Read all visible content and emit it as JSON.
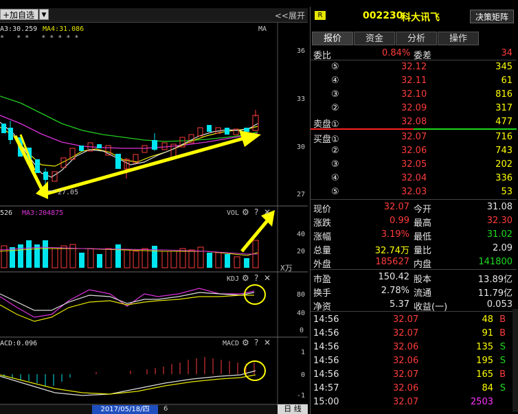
{
  "toolbar": {
    "add_label": "+加自选",
    "dropdown": "▼",
    "expand_label": "<<展开"
  },
  "ma": {
    "ma3": "A3:30.259",
    "ma4": "MA4:31.086",
    "tag": "MA",
    "stars": "*   * *   * * * * *"
  },
  "price_axis": [
    "36",
    "33",
    "30",
    "27"
  ],
  "low_label": "27.05",
  "vol": {
    "ma_prefix": "526",
    "ma3": "MA3:204875",
    "tag": "VOL",
    "axis": [
      "40",
      "20"
    ],
    "unit": "X万"
  },
  "kdj": {
    "tag": "KDJ",
    "axis": [
      "80",
      "40",
      "0"
    ]
  },
  "macd": {
    "label": "ACD:0.096",
    "tag": "MACD",
    "axis": [
      "1",
      "0",
      "-1"
    ]
  },
  "bottom": {
    "date": "2017/05/18/四",
    "count": "6",
    "period": "日  线"
  },
  "panel": {
    "badge": "R",
    "code": "002230",
    "name": "科大讯飞",
    "decision_button": "决策矩阵",
    "tabs": [
      "报价",
      "资金",
      "分析",
      "操作"
    ],
    "weibi_label": "委比",
    "weibi_value": "0.84%",
    "weicha_label": "委差",
    "weicha_value": "34",
    "sell": [
      {
        "label": "⑤",
        "price": "32.12",
        "vol": "345"
      },
      {
        "label": "④",
        "price": "32.11",
        "vol": "61"
      },
      {
        "label": "③",
        "price": "32.10",
        "vol": "816"
      },
      {
        "label": "②",
        "price": "32.09",
        "vol": "317"
      },
      {
        "label": "卖盘①",
        "price": "32.08",
        "vol": "477"
      }
    ],
    "buy": [
      {
        "label": "买盘①",
        "price": "32.07",
        "vol": "716"
      },
      {
        "label": "②",
        "price": "32.06",
        "vol": "743"
      },
      {
        "label": "③",
        "price": "32.05",
        "vol": "202"
      },
      {
        "label": "④",
        "price": "32.04",
        "vol": "336"
      },
      {
        "label": "⑤",
        "price": "32.03",
        "vol": "53"
      }
    ],
    "quote": [
      {
        "l1": "现价",
        "v1": "32.07",
        "l2": "今开",
        "v2": "31.08",
        "c1": "red",
        "c2": "wht"
      },
      {
        "l1": "涨跌",
        "v1": "0.99",
        "l2": "最高",
        "v2": "32.30",
        "c1": "red",
        "c2": "red"
      },
      {
        "l1": "涨幅",
        "v1": "3.19%",
        "l2": "最低",
        "v2": "31.02",
        "c1": "red",
        "c2": "grn"
      },
      {
        "l1": "总量",
        "v1": "32.74万",
        "l2": "量比",
        "v2": "2.09",
        "c1": "yel",
        "c2": "wht"
      },
      {
        "l1": "外盘",
        "v1": "185627",
        "l2": "内盘",
        "v2": "141800",
        "c1": "red",
        "c2": "grn"
      }
    ],
    "fund": [
      {
        "l1": "市盈",
        "v1": "150.42",
        "l2": "股本",
        "v2": "13.89亿"
      },
      {
        "l1": "换手",
        "v1": "2.78%",
        "l2": "流通",
        "v2": "11.79亿"
      },
      {
        "l1": "净资",
        "v1": "5.37",
        "l2": "收益(一)",
        "v2": "0.053"
      }
    ],
    "ticks": [
      {
        "time": "14:56",
        "price": "32.07",
        "vol": "48",
        "side": "B"
      },
      {
        "time": "14:56",
        "price": "32.07",
        "vol": "91",
        "side": "B"
      },
      {
        "time": "14:56",
        "price": "32.06",
        "vol": "135",
        "side": "S"
      },
      {
        "time": "14:56",
        "price": "32.06",
        "vol": "195",
        "side": "S"
      },
      {
        "time": "14:56",
        "price": "32.07",
        "vol": "165",
        "side": "B"
      },
      {
        "time": "14:57",
        "price": "32.06",
        "vol": "84",
        "side": "S"
      },
      {
        "time": "15:00",
        "price": "32.07",
        "vol": "2503",
        "side": ""
      }
    ]
  }
}
